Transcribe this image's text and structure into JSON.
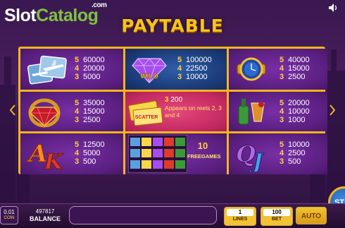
{
  "brand": {
    "slot": "Slot",
    "catalog": "Catalog",
    "com": ".com"
  },
  "title": "PAYTABLE",
  "symbols": [
    {
      "id": "jet",
      "pays": [
        {
          "n": "5",
          "v": "60000"
        },
        {
          "n": "4",
          "v": "20000"
        },
        {
          "n": "3",
          "v": "5000"
        }
      ]
    },
    {
      "id": "wild-diamond",
      "label": "WILD",
      "pays": [
        {
          "n": "5",
          "v": "100000"
        },
        {
          "n": "4",
          "v": "22500"
        },
        {
          "n": "3",
          "v": "10000"
        }
      ]
    },
    {
      "id": "watch",
      "pays": [
        {
          "n": "5",
          "v": "40000"
        },
        {
          "n": "4",
          "v": "15000"
        },
        {
          "n": "3",
          "v": "2500"
        }
      ]
    },
    {
      "id": "ruby-ring",
      "pays": [
        {
          "n": "5",
          "v": "35000"
        },
        {
          "n": "4",
          "v": "15000"
        },
        {
          "n": "3",
          "v": "2500"
        }
      ]
    },
    {
      "id": "scatter-ticket",
      "label": "SCATTER",
      "pays": [
        {
          "n": "3",
          "v": "200"
        }
      ],
      "note": "Appears on reels 2, 3 and 4"
    },
    {
      "id": "drinks",
      "pays": [
        {
          "n": "5",
          "v": "20000"
        },
        {
          "n": "4",
          "v": "10000"
        },
        {
          "n": "3",
          "v": "1000"
        }
      ]
    },
    {
      "id": "ace-king",
      "pays": [
        {
          "n": "5",
          "v": "12500"
        },
        {
          "n": "4",
          "v": "5000"
        },
        {
          "n": "3",
          "v": "500"
        }
      ]
    },
    {
      "id": "freegames-reels",
      "free_count": "10",
      "free_label": "FREEGAMES"
    },
    {
      "id": "queen-jack",
      "pays": [
        {
          "n": "5",
          "v": "10000"
        },
        {
          "n": "4",
          "v": "2500"
        },
        {
          "n": "3",
          "v": "500"
        }
      ]
    }
  ],
  "bottom_bar": {
    "coin_value": "0.01",
    "coin_label": "COIN",
    "balance_value": "497817",
    "balance_label": "BALANCE",
    "lines_value": "1",
    "lines_label": "LINES",
    "bet_value": "100",
    "bet_label": "BET",
    "auto_label": "AUTO",
    "spin_label": "ST"
  },
  "colors": {
    "frame": "#f2b51e",
    "purple_cell": "#5a1f80",
    "blue_cell": "#1b3a78",
    "pink_cell": "#c42a62",
    "pay_number": "#ffd23a"
  }
}
